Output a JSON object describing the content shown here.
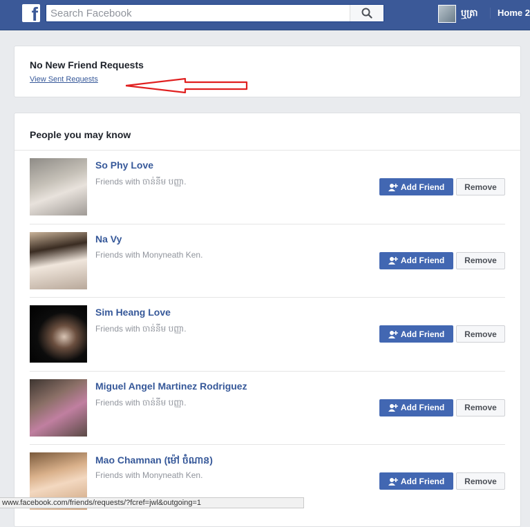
{
  "topbar": {
    "logo": "f",
    "search_placeholder": "Search Facebook",
    "profile_name": "ឬត្រា",
    "home_label": "Home",
    "home_suffix": "2"
  },
  "requests": {
    "title": "No New Friend Requests",
    "sent_link": "View Sent Requests"
  },
  "suggestions": {
    "header": "People you may know",
    "add_label": "Add Friend",
    "remove_label": "Remove",
    "people": [
      {
        "name": "So Phy Love",
        "mutual": "Friends with ចាន់នីម បញ្ញា."
      },
      {
        "name": "Na Vy",
        "mutual": "Friends with Monyneath Ken."
      },
      {
        "name": "Sim Heang Love",
        "mutual": "Friends with ចាន់នីម បញ្ញា."
      },
      {
        "name": "Miguel Angel Martinez Rodriguez",
        "mutual": "Friends with ចាន់នីម បញ្ញា."
      },
      {
        "name": "Mao Chamnan (ម៉ៅ ចំណាន)",
        "mutual": "Friends with Monyneath Ken."
      }
    ]
  },
  "status_bar": {
    "url": "www.facebook.com/friends/requests/?fcref=jwl&outgoing=1"
  },
  "colors": {
    "brand": "#3b5998",
    "link": "#365899",
    "add_button": "#4267b2",
    "annotation_arrow": "#e02020"
  },
  "icons": [
    "facebook-logo-icon",
    "search-icon",
    "add-friend-icon",
    "red-arrow-annotation"
  ]
}
